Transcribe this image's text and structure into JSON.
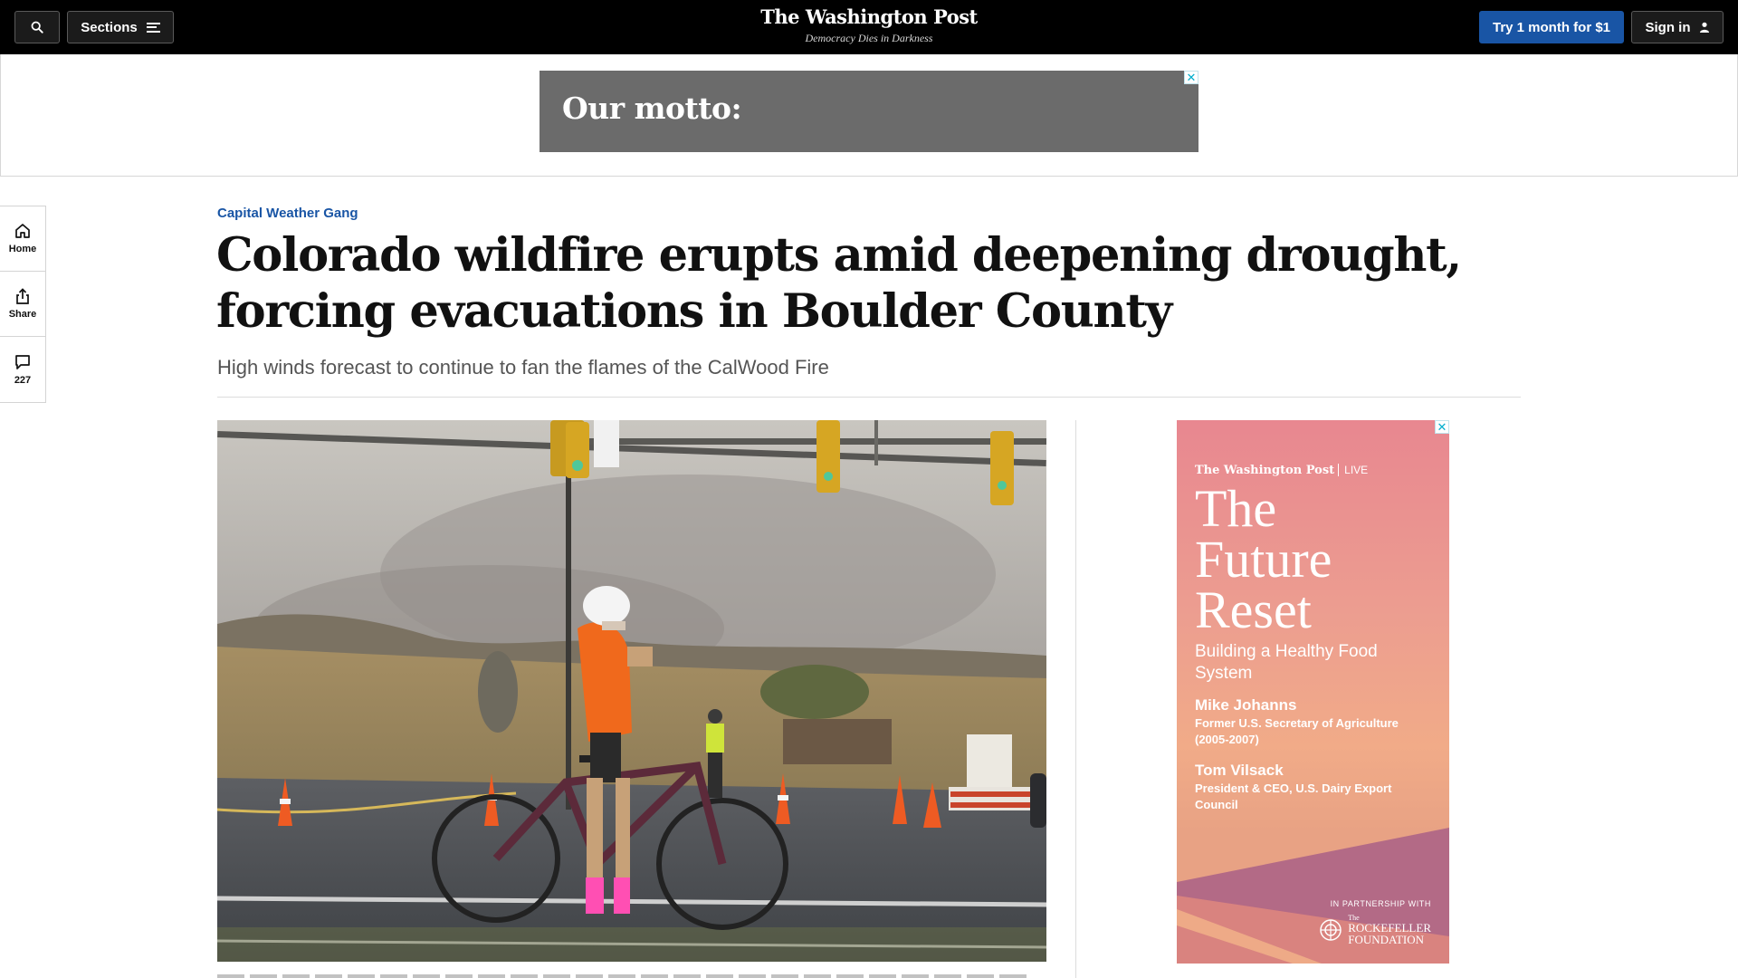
{
  "topbar": {
    "sections_label": "Sections",
    "logo": "The Washington Post",
    "tagline": "Democracy Dies in Darkness",
    "subscribe_label": "Try 1 month for $1",
    "signin_label": "Sign in"
  },
  "ads": {
    "banner_text": "Our motto:",
    "close_glyph": "✕",
    "side": {
      "brand": "The Washington Post",
      "brand_suffix": "LIVE",
      "title_line1": "The",
      "title_line2": "Future",
      "title_line3": "Reset",
      "subtitle": "Building a Healthy Food System",
      "person1_name": "Mike Johanns",
      "person1_role": "Former U.S. Secretary of Agriculture (2005-2007)",
      "person2_name": "Tom Vilsack",
      "person2_role": "President & CEO, U.S. Dairy Export Council",
      "partner_label": "IN PARTNERSHIP WITH",
      "partner_the": "The",
      "partner_name1": "ROCKEFELLER",
      "partner_name2": "FOUNDATION"
    }
  },
  "rail": {
    "home_label": "Home",
    "share_label": "Share",
    "comments_count": "227"
  },
  "article": {
    "kicker": "Capital Weather Gang",
    "headline": "Colorado wildfire erupts amid deepening drought, forcing evacuations in Boulder County",
    "dek": "High winds forecast to continue to fan the flames of the CalWood Fire"
  },
  "colors": {
    "topbar_bg": "#000000",
    "accent_blue": "#1955a5",
    "ad_gray": "#6b6b6b",
    "ad_close": "#00aecd"
  }
}
